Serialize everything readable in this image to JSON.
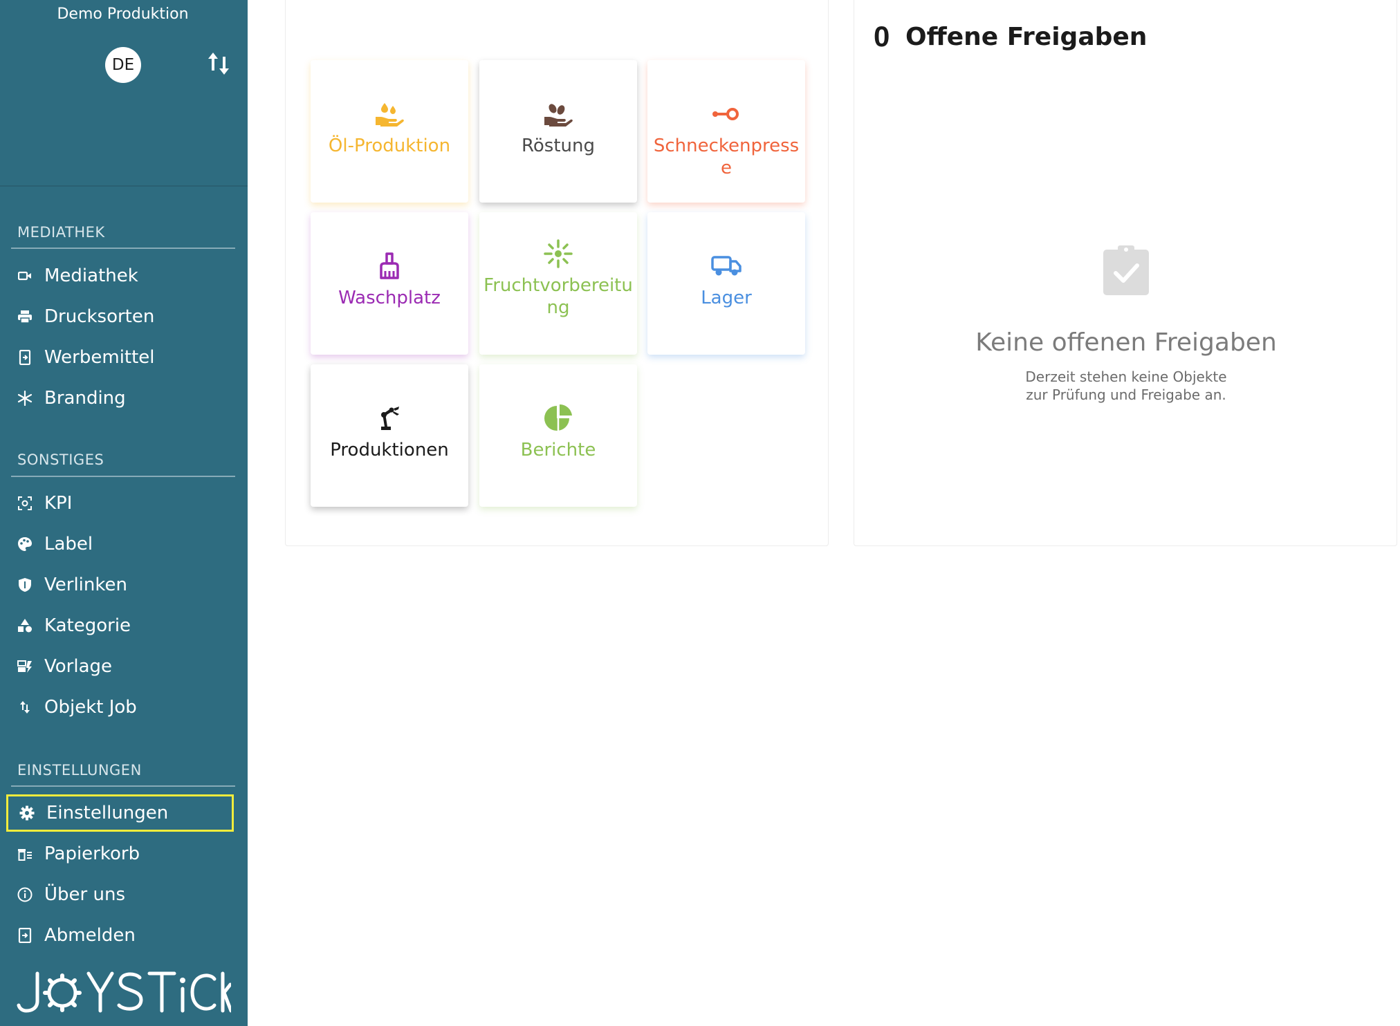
{
  "sidebar": {
    "org_name": "Demo Produktion",
    "language": "DE",
    "sections": [
      {
        "title": "MEDIATHEK",
        "items": [
          {
            "label": "Mediathek",
            "icon": "video-icon"
          },
          {
            "label": "Drucksorten",
            "icon": "print-icon"
          },
          {
            "label": "Werbemittel",
            "icon": "file-export-icon"
          },
          {
            "label": "Branding",
            "icon": "snowflake-icon"
          }
        ]
      },
      {
        "title": "SONSTIGES",
        "items": [
          {
            "label": "KPI",
            "icon": "target-icon"
          },
          {
            "label": "Label",
            "icon": "palette-icon"
          },
          {
            "label": "Verlinken",
            "icon": "shield-icon"
          },
          {
            "label": "Kategorie",
            "icon": "shapes-icon"
          },
          {
            "label": "Vorlage",
            "icon": "template-icon"
          },
          {
            "label": "Objekt Job",
            "icon": "swap-vertical-icon"
          }
        ]
      },
      {
        "title": "EINSTELLUNGEN",
        "items": [
          {
            "label": "Einstellungen",
            "icon": "gear-icon",
            "active": true
          },
          {
            "label": "Papierkorb",
            "icon": "trash-icon"
          },
          {
            "label": "Über uns",
            "icon": "info-icon"
          },
          {
            "label": "Abmelden",
            "icon": "logout-icon"
          }
        ]
      }
    ],
    "brand": "JOYSTICK"
  },
  "tiles": [
    {
      "label": "Öl-Produktion",
      "icon": "oil-hand-icon",
      "color": "#f5b630"
    },
    {
      "label": "Röstung",
      "icon": "roast-hand-icon",
      "color": "#6b4a3e"
    },
    {
      "label": "Schneckenpresse",
      "icon": "key-press-icon",
      "color": "#f0643c"
    },
    {
      "label": "Waschplatz",
      "icon": "broom-icon",
      "color": "#9b2bb3"
    },
    {
      "label": "Fruchtvorbereitung",
      "icon": "sparkle-icon",
      "color": "#8cc152"
    },
    {
      "label": "Lager",
      "icon": "truck-icon",
      "color": "#4a8fe0"
    },
    {
      "label": "Produktionen",
      "icon": "robot-arm-icon",
      "color": "#1b1b1b"
    },
    {
      "label": "Berichte",
      "icon": "pie-chart-icon",
      "color": "#8cc152"
    }
  ],
  "approvals": {
    "count": "0",
    "title": "Offene Freigaben",
    "empty_title": "Keine offenen Freigaben",
    "empty_line1": "Derzeit stehen keine Objekte",
    "empty_line2": "zur Prüfung und Freigabe an."
  }
}
